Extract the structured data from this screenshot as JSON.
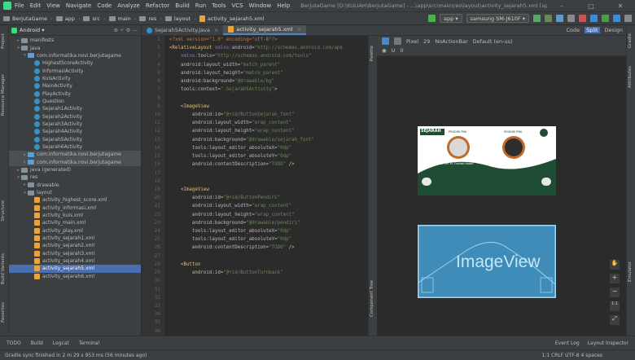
{
  "menu": {
    "items": [
      "File",
      "Edit",
      "View",
      "Navigate",
      "Code",
      "Analyze",
      "Refactor",
      "Build",
      "Run",
      "Tools",
      "VCS",
      "Window",
      "Help"
    ],
    "title": "BerjutaGame [D:\\KULIAH\\BerjutaGame] - ...\\app\\src\\main\\res\\layout\\activity_sejarah5.xml [app] - Android Studio"
  },
  "breadcrumbs": [
    "BerjutaGame",
    "app",
    "src",
    "main",
    "res",
    "layout",
    "activity_sejarah5.xml"
  ],
  "toolbar": {
    "module": "app",
    "device": "samsung SM-J610F"
  },
  "project": {
    "header": "Android",
    "items": [
      {
        "label": "manifests",
        "indent": 1,
        "kind": "folder",
        "arrow": "▸"
      },
      {
        "label": "java",
        "indent": 1,
        "kind": "folder",
        "arrow": "▾"
      },
      {
        "label": "com.informatika.novi.berjutagame",
        "indent": 2,
        "kind": "folder",
        "arrow": "▾"
      },
      {
        "label": "HighestScoreActivity",
        "indent": 3,
        "kind": "class"
      },
      {
        "label": "InformasiActivity",
        "indent": 3,
        "kind": "class"
      },
      {
        "label": "KuisActivity",
        "indent": 3,
        "kind": "class"
      },
      {
        "label": "MainActivity",
        "indent": 3,
        "kind": "class"
      },
      {
        "label": "PlayActivity",
        "indent": 3,
        "kind": "class"
      },
      {
        "label": "Question",
        "indent": 3,
        "kind": "class"
      },
      {
        "label": "Sejarah1Activity",
        "indent": 3,
        "kind": "class"
      },
      {
        "label": "Sejarah2Activity",
        "indent": 3,
        "kind": "class"
      },
      {
        "label": "Sejarah3Activity",
        "indent": 3,
        "kind": "class"
      },
      {
        "label": "Sejarah4Activity",
        "indent": 3,
        "kind": "class"
      },
      {
        "label": "Sejarah5Activity",
        "indent": 3,
        "kind": "class"
      },
      {
        "label": "Sejarah6Activity",
        "indent": 3,
        "kind": "class"
      },
      {
        "label": "com.informatika.novi.berjutagame",
        "indent": 2,
        "kind": "folder",
        "arrow": "▸",
        "state": "hl"
      },
      {
        "label": "com.informatika.novi.berjutagame",
        "indent": 2,
        "kind": "folder",
        "arrow": "▸",
        "state": "hl"
      },
      {
        "label": "java (generated)",
        "indent": 1,
        "kind": "folder",
        "arrow": "▸"
      },
      {
        "label": "res",
        "indent": 1,
        "kind": "folder",
        "arrow": "▾"
      },
      {
        "label": "drawable",
        "indent": 2,
        "kind": "folder",
        "arrow": "▸"
      },
      {
        "label": "layout",
        "indent": 2,
        "kind": "folder",
        "arrow": "▾"
      },
      {
        "label": "activity_highest_score.xml",
        "indent": 3,
        "kind": "xml"
      },
      {
        "label": "activity_informasi.xml",
        "indent": 3,
        "kind": "xml"
      },
      {
        "label": "activity_kuis.xml",
        "indent": 3,
        "kind": "xml"
      },
      {
        "label": "activity_main.xml",
        "indent": 3,
        "kind": "xml"
      },
      {
        "label": "activity_play.xml",
        "indent": 3,
        "kind": "xml"
      },
      {
        "label": "activity_sejarah1.xml",
        "indent": 3,
        "kind": "xml"
      },
      {
        "label": "activity_sejarah2.xml",
        "indent": 3,
        "kind": "xml"
      },
      {
        "label": "activity_sejarah3.xml",
        "indent": 3,
        "kind": "xml"
      },
      {
        "label": "activity_sejarah4.xml",
        "indent": 3,
        "kind": "xml"
      },
      {
        "label": "activity_sejarah5.xml",
        "indent": 3,
        "kind": "xml",
        "state": "sel"
      },
      {
        "label": "activity_sejarah6.xml",
        "indent": 3,
        "kind": "xml"
      }
    ]
  },
  "tabs": [
    {
      "label": "Sejarah5Activity.java",
      "active": false
    },
    {
      "label": "activity_sejarah5.xml",
      "active": true
    }
  ],
  "line_numbers": [
    "1",
    "2",
    "3",
    "4",
    "5",
    "6",
    "7",
    "8",
    "9",
    "10",
    "11",
    "12",
    "13",
    "14",
    "15",
    "16",
    "17",
    "18",
    "19",
    "20",
    "21",
    "22",
    "23",
    "24",
    "25",
    "26",
    "27",
    "28",
    "29",
    "30",
    "31",
    "32",
    "33",
    "34",
    "35",
    "36"
  ],
  "code": [
    [
      [
        "pi",
        "<?xml version=\"1.0\" encoding=\"utf-8\"?>"
      ]
    ],
    [
      [
        "tg",
        "<RelativeLayout "
      ],
      [
        "ns",
        "xmlns:"
      ],
      [
        "at",
        "android="
      ],
      [
        "av",
        "\"http://schemas.android.com/apk"
      ]
    ],
    [
      [
        "at",
        "    "
      ],
      [
        "ns",
        "xmlns:"
      ],
      [
        "at",
        "tools="
      ],
      [
        "av",
        "\"http://schemas.android.com/tools\""
      ]
    ],
    [
      [
        "at",
        "    android:layout_width="
      ],
      [
        "av",
        "\"match_parent\""
      ]
    ],
    [
      [
        "at",
        "    android:layout_height="
      ],
      [
        "av",
        "\"match_parent\""
      ]
    ],
    [
      [
        "at",
        "    android:background="
      ],
      [
        "av",
        "\"@drawable/bg\""
      ]
    ],
    [
      [
        "at",
        "    tools:context="
      ],
      [
        "av",
        "\".Sejarah5Activity\""
      ],
      [
        "tg",
        ">"
      ]
    ],
    [
      [
        "at",
        ""
      ]
    ],
    [
      [
        "tg",
        "    <ImageView"
      ]
    ],
    [
      [
        "at",
        "        android:id="
      ],
      [
        "av",
        "\"@+id/ButtonSejarah_font\""
      ]
    ],
    [
      [
        "at",
        "        android:layout_width="
      ],
      [
        "av",
        "\"wrap_content\""
      ]
    ],
    [
      [
        "at",
        "        android:layout_height="
      ],
      [
        "av",
        "\"wrap_content\""
      ]
    ],
    [
      [
        "at",
        "        android:background="
      ],
      [
        "av",
        "\"@drawable/sejarah_font\""
      ]
    ],
    [
      [
        "at",
        "        tools:layout_editor_absoluteX="
      ],
      [
        "av",
        "\"0dp\""
      ]
    ],
    [
      [
        "at",
        "        tools:layout_editor_absoluteY="
      ],
      [
        "av",
        "\"0dp\""
      ]
    ],
    [
      [
        "at",
        "        android:contentDescription="
      ],
      [
        "av",
        "\"TODO\""
      ],
      [
        "tg",
        " />"
      ]
    ],
    [
      [
        "at",
        ""
      ]
    ],
    [
      [
        "at",
        ""
      ]
    ],
    [
      [
        "tg",
        "    <ImageView"
      ]
    ],
    [
      [
        "at",
        "        android:id="
      ],
      [
        "av",
        "\"@+id/ButtonPendiri\""
      ]
    ],
    [
      [
        "at",
        "        android:layout_width="
      ],
      [
        "av",
        "\"wrap_content\""
      ]
    ],
    [
      [
        "at",
        "        android:layout_height="
      ],
      [
        "av",
        "\"wrap_content\""
      ]
    ],
    [
      [
        "at",
        "        android:background="
      ],
      [
        "av",
        "\"@drawable/pendiri\""
      ]
    ],
    [
      [
        "at",
        "        tools:layout_editor_absoluteX="
      ],
      [
        "av",
        "\"0dp\""
      ]
    ],
    [
      [
        "at",
        "        tools:layout_editor_absoluteY="
      ],
      [
        "av",
        "\"0dp\""
      ]
    ],
    [
      [
        "at",
        "        android:contentDescription="
      ],
      [
        "av",
        "\"TODO\""
      ],
      [
        "tg",
        " />"
      ]
    ],
    [
      [
        "at",
        ""
      ]
    ],
    [
      [
        "tg",
        "    <Button"
      ]
    ],
    [
      [
        "at",
        "        android:id="
      ],
      [
        "av",
        "\"@+id/ButtonTurnback\""
      ]
    ]
  ],
  "design": {
    "modes": [
      "Code",
      "Split",
      "Design"
    ],
    "toolbar": [
      "Pixel",
      "29",
      "NoActionBar",
      "Default (en-us)"
    ],
    "preview_title": "SEJARAH",
    "preview_tag1": "PENDIRI PMII",
    "preview_tag2": "PENDIRI PMII",
    "preview_name1": "Prof. Dr. KH. M. Thohlah Hasan",
    "preview_name2": "Syaf Q. Siradj Kalijakob",
    "blueprint_label": "ImageView"
  },
  "left_tabs": [
    "Project",
    "Resource Manager",
    "Structure",
    "Build Variants",
    "Favorites"
  ],
  "right_tabs": [
    "Gradle",
    "Attributes",
    "Emulator"
  ],
  "bottom": [
    "TODO",
    "Build",
    "Logcat",
    "Terminal"
  ],
  "bottom_right": [
    "Event Log",
    "Layout Inspector"
  ],
  "status": {
    "left": "Gradle sync finished in 2 m 29 s 953 ms (56 minutes ago)",
    "right": "1:1  CRLF  UTF-8  4 spaces"
  }
}
